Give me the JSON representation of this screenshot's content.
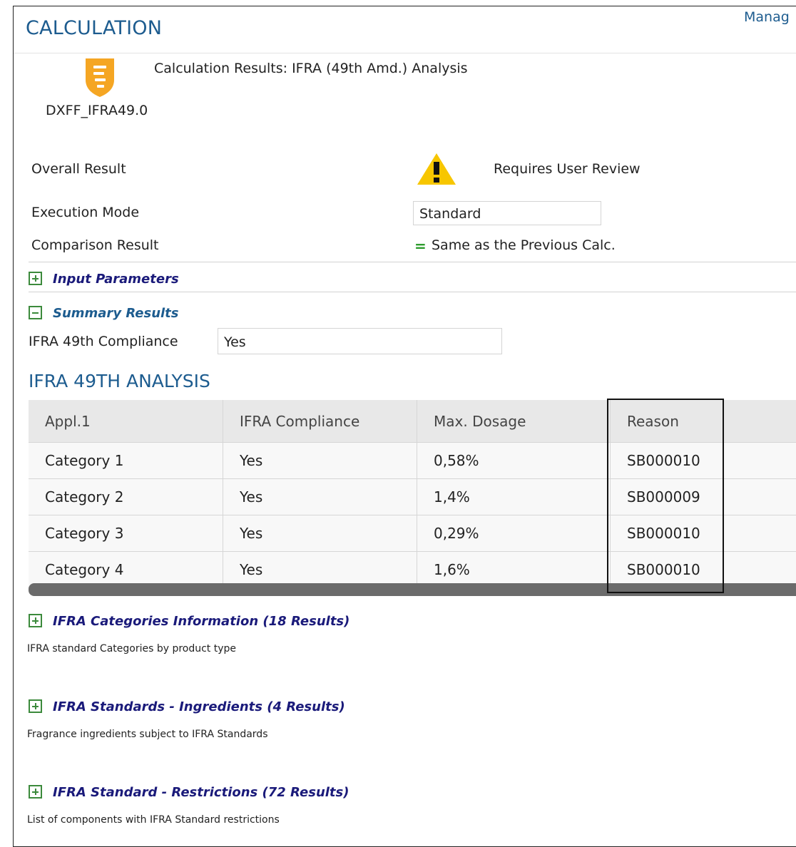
{
  "header": {
    "title": "CALCULATION",
    "manage_link": "Manag"
  },
  "calc": {
    "results_title": "Calculation Results: IFRA (49th Amd.) Analysis",
    "code": "DXFF_IFRA49.0",
    "icon": "shield-icon"
  },
  "overall": {
    "label": "Overall Result",
    "status": "Requires User Review",
    "icon": "warning-icon"
  },
  "execution": {
    "label": "Execution Mode",
    "value": "Standard"
  },
  "comparison": {
    "label": "Comparison Result",
    "symbol": "=",
    "value": "Same as the Previous Calc."
  },
  "sections": {
    "input_parameters": "Input Parameters",
    "summary_results": "Summary Results"
  },
  "summary": {
    "compliance_label": "IFRA 49th Compliance",
    "compliance_value": "Yes"
  },
  "analysis": {
    "title": "IFRA 49TH ANALYSIS",
    "columns": [
      "Appl.1",
      "IFRA Compliance",
      "Max. Dosage",
      "Reason"
    ],
    "rows": [
      [
        "Category 1",
        "Yes",
        "0,58%",
        "SB000010"
      ],
      [
        "Category 2",
        "Yes",
        "1,4%",
        "SB000009"
      ],
      [
        "Category 3",
        "Yes",
        "0,29%",
        "SB000010"
      ],
      [
        "Category 4",
        "Yes",
        "1,6%",
        "SB000010"
      ]
    ]
  },
  "collapsed_sections": [
    {
      "title": "IFRA Categories Information (18 Results)",
      "description": "IFRA standard Categories by product type"
    },
    {
      "title": "IFRA Standards - Ingredients (4 Results)",
      "description": "Fragrance ingredients subject to IFRA Standards"
    },
    {
      "title": "IFRA Standard - Restrictions (72 Results)",
      "description": "List of components with IFRA Standard restrictions"
    }
  ],
  "colors": {
    "accent_blue": "#1d5c8f",
    "section_title": "#1a1a7a",
    "toggle_green": "#3c8a3c",
    "shield_orange": "#f5a623",
    "warning_yellow": "#f7c600"
  }
}
